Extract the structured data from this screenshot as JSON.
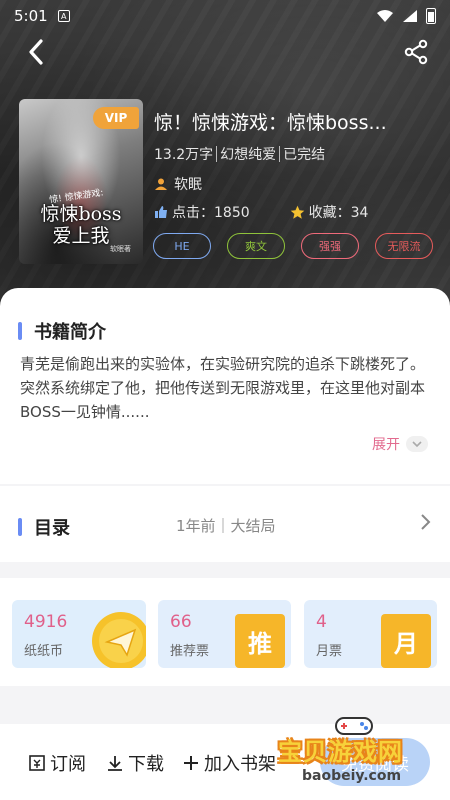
{
  "status_bar": {
    "time": "5:01",
    "notif_glyph": "A"
  },
  "nav": {
    "back_icon": "chevron-left-icon",
    "share_icon": "share-icon"
  },
  "book": {
    "cover": {
      "badge": "VIP",
      "small_text": "惊! 惊悚游戏:",
      "title_line1": "惊悚boss",
      "title_line2": "爱上我",
      "author_small": "软眠著"
    },
    "title": "惊！惊悚游戏：惊悚boss...",
    "meta": [
      "13.2万字",
      "幻想纯爱",
      "已完结"
    ],
    "author": "软眠",
    "clicks_label": "点击：1850",
    "favorites_label": "收藏：34",
    "tags": [
      {
        "label": "HE",
        "color": "#7fa9f0"
      },
      {
        "label": "爽文",
        "color": "#8fc33b"
      },
      {
        "label": "强强",
        "color": "#ef6a7a"
      },
      {
        "label": "无限流",
        "color": "#e55b5b"
      }
    ]
  },
  "intro": {
    "title": "书籍简介",
    "text": "青芜是偷跑出来的实验体，在实验研究院的追杀下跳楼死了。突然系统绑定了他，把他传送到无限游戏里，在这里他对副本BOSS一见钟情......",
    "expand_label": "展开"
  },
  "toc": {
    "title": "目录",
    "info": "1年前｜大结局"
  },
  "tickets": [
    {
      "value": "4916",
      "label": "纸纸币",
      "color": "#e0608a",
      "icon": "paper-plane-coin-icon"
    },
    {
      "value": "66",
      "label": "推荐票",
      "color": "#e0608a",
      "icon_text": "推"
    },
    {
      "value": "4",
      "label": "月票",
      "color": "#e0608a",
      "icon_text": "月"
    }
  ],
  "bottom_bar": {
    "subscribe": "订阅",
    "download": "下载",
    "add_shelf": "加入书架",
    "read": "免费阅读"
  },
  "watermark": {
    "title": "宝贝游戏网",
    "url": "baobeiy.com"
  }
}
